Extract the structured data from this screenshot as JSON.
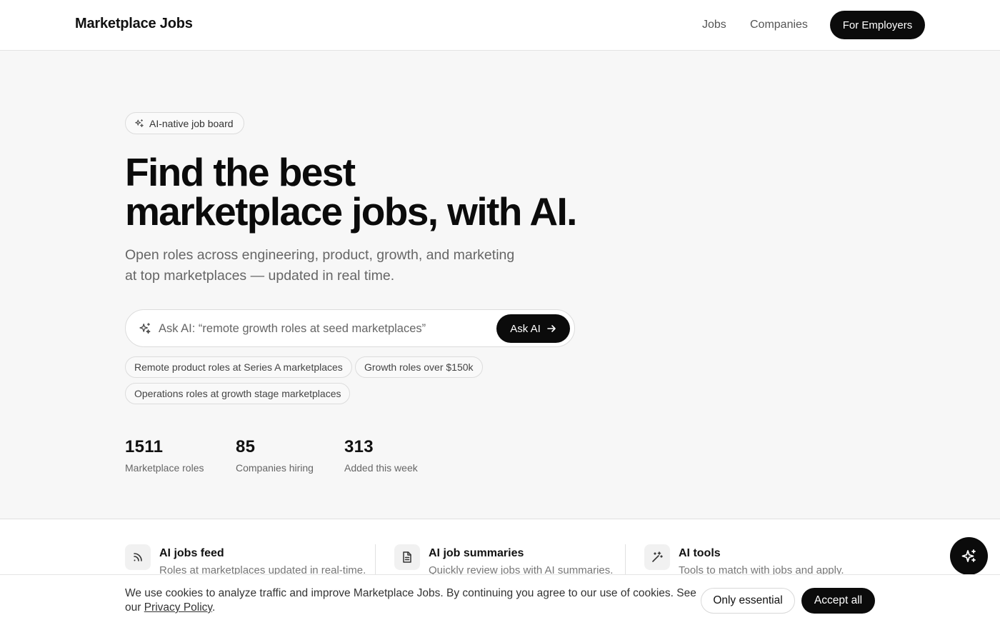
{
  "header": {
    "brand": "Marketplace Jobs",
    "nav": {
      "jobs": "Jobs",
      "companies": "Companies"
    },
    "employers_button": "For Employers"
  },
  "hero": {
    "badge": "AI-native job board",
    "title_line1": "Find the best",
    "title_line2": "marketplace jobs, with AI.",
    "subtitle_line1": "Open roles across engineering, product, growth, and marketing",
    "subtitle_line2": "at top marketplaces — updated in real time.",
    "search_placeholder": "Ask AI: “remote growth roles at seed marketplaces”",
    "ask_button": "Ask AI",
    "suggestions": [
      "Remote product roles at Series A marketplaces",
      "Growth roles over $150k",
      "Operations roles at growth stage marketplaces"
    ]
  },
  "stats": [
    {
      "value": "1511",
      "label": "Marketplace roles"
    },
    {
      "value": "85",
      "label": "Companies hiring"
    },
    {
      "value": "313",
      "label": "Added this week"
    }
  ],
  "features": [
    {
      "icon": "rss-icon",
      "title": "AI jobs feed",
      "desc": "Roles at marketplaces updated in real-time."
    },
    {
      "icon": "document-icon",
      "title": "AI job summaries",
      "desc": "Quickly review jobs with AI summaries."
    },
    {
      "icon": "magic-wand-icon",
      "title": "AI tools",
      "desc": "Tools to match with jobs and apply."
    }
  ],
  "cookie": {
    "text_before": "We use cookies to analyze traffic and improve Marketplace Jobs. By continuing you agree to our use of cookies. See our ",
    "link": "Privacy Policy",
    "text_after": ".",
    "essential_button": "Only essential",
    "accept_button": "Accept all"
  },
  "colors": {
    "accent": "#0b0b0b",
    "background": "#f7f7f7",
    "muted_text": "#666666"
  }
}
